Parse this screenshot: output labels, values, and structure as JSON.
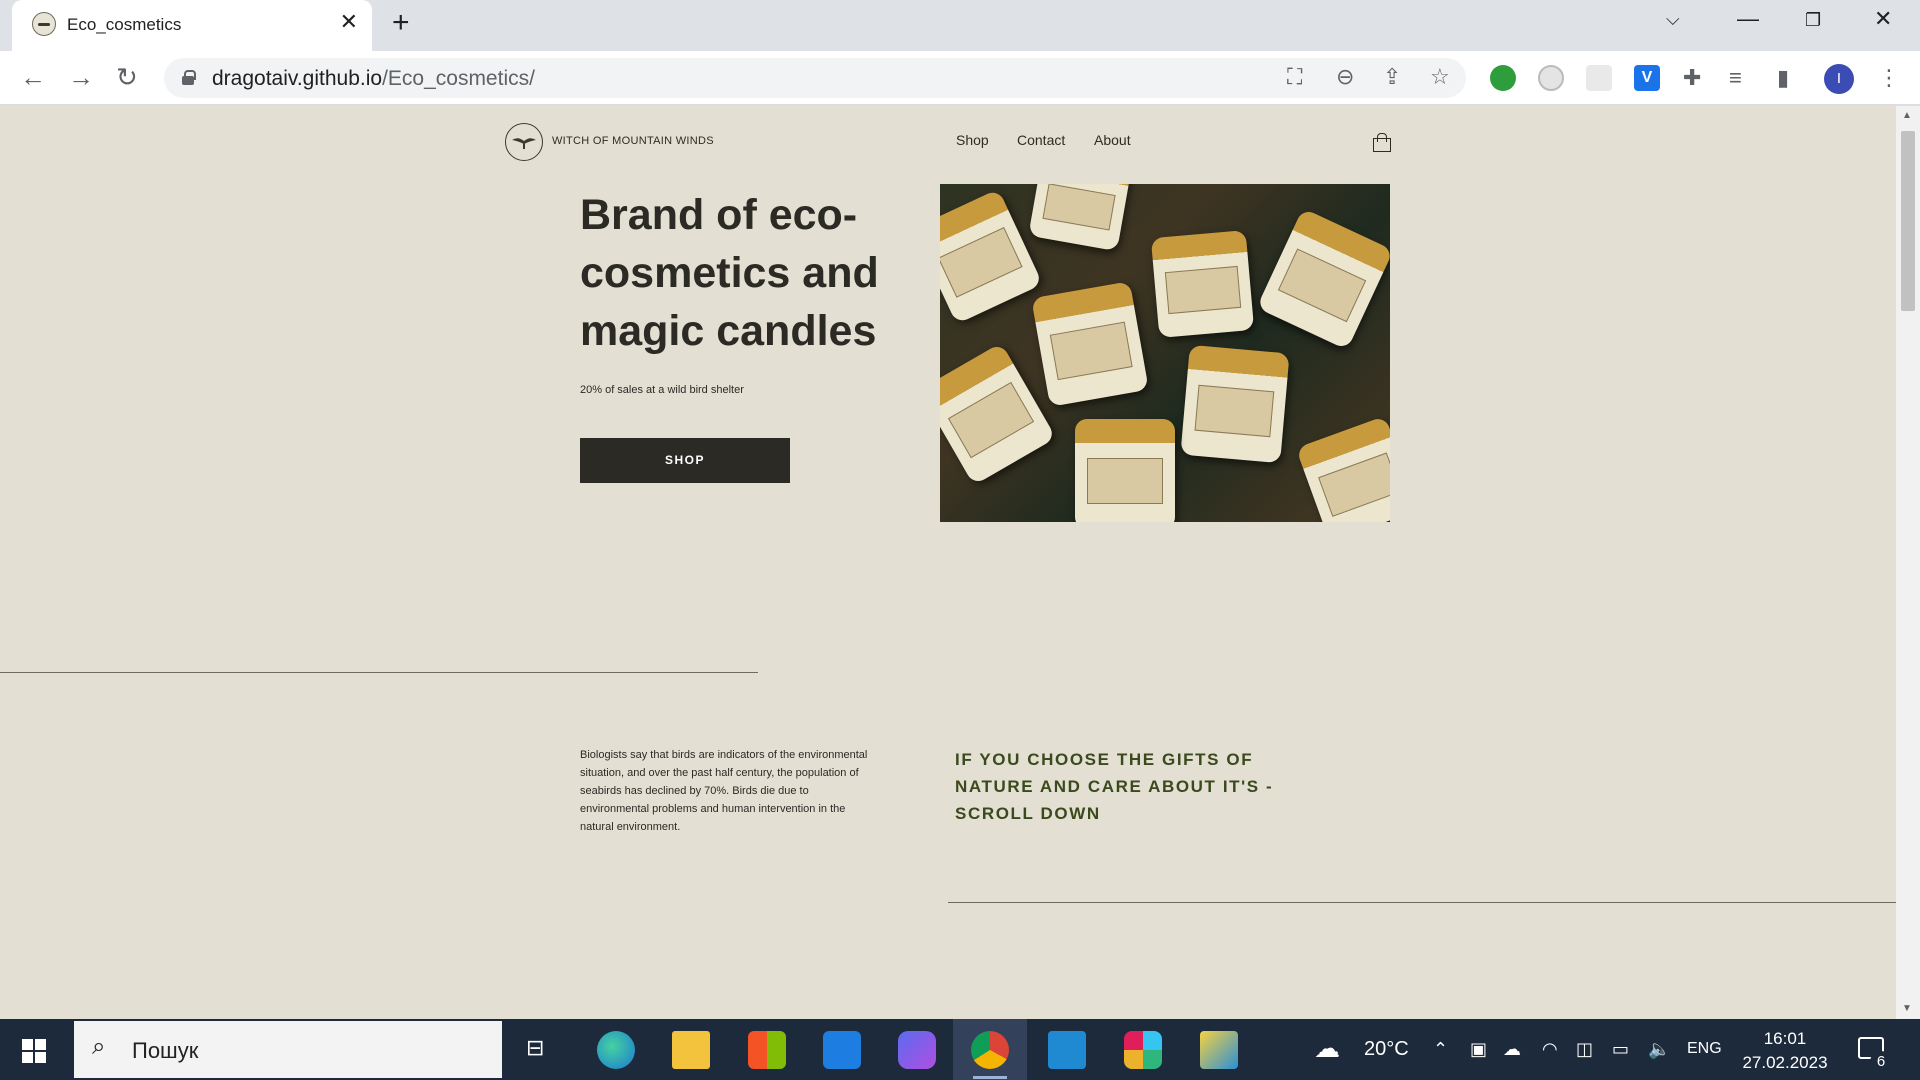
{
  "browser": {
    "tab_title": "Eco_cosmetics",
    "url_host": "dragotaiv.github.io",
    "url_path": "/Eco_cosmetics/"
  },
  "site": {
    "logo_text": "WITCH OF MOUNTAIN WINDS",
    "nav": [
      {
        "label": "Shop"
      },
      {
        "label": "Contact"
      },
      {
        "label": "About"
      }
    ],
    "hero": {
      "title": "Brand of eco-cosmetics and magic candles",
      "subtitle": "20% of sales at a wild bird shelter",
      "button": "SHOP"
    },
    "bio_text": "Biologists say that birds are indicators of the environmental situation, and over the past half century, the population of seabirds has declined by 70%. Birds die due to environmental problems and human intervention in the natural environment.",
    "scroll_cta": "IF YOU CHOOSE THE GIFTS OF NATURE AND CARE ABOUT IT'S - SCROLL DOWN"
  },
  "taskbar": {
    "search_placeholder": "Пошук",
    "weather": "20°C",
    "language": "ENG",
    "time": "16:01",
    "date": "27.02.2023",
    "notifications": "6"
  },
  "colors": {
    "page_bg": "#e3dfd2",
    "text_dark": "#2b2a25",
    "cta_green": "#3a4a1c",
    "button_bg": "#2b2a25",
    "taskbar_bg": "#1d2a3c"
  }
}
